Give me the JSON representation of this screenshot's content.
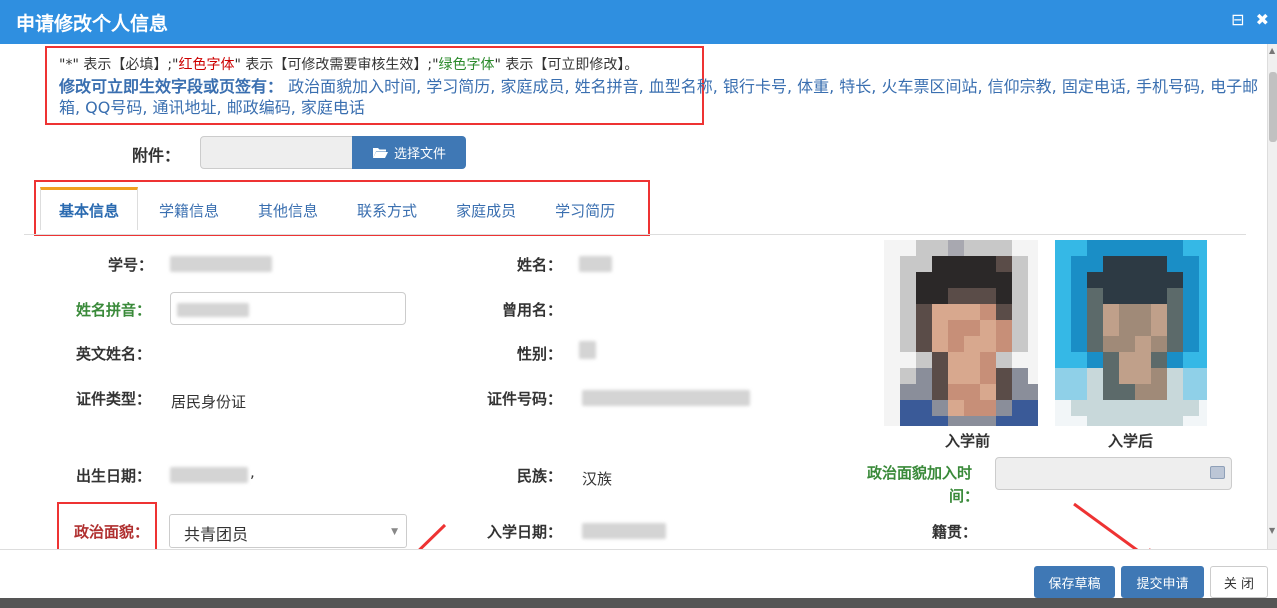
{
  "window": {
    "title": "申请修改个人信息",
    "restore_glyph": "⊟",
    "close_glyph": "✖"
  },
  "notice": {
    "l1_part1": "\"*\" 表示【必填】;\"",
    "l1_red": "红色字体",
    "l1_part2": "\" 表示【可修改需要审核生效】;\"",
    "l1_green": "绿色字体",
    "l1_part3": "\" 表示【可立即修改】。",
    "l2_bold": "修改可立即生效字段或页签有：",
    "l2_fields": " 政治面貌加入时间, 学习简历, 家庭成员, 姓名拼音, 血型名称, 银行卡号, 体重, 特长, 火车票区间站, 信仰宗教, 固定电话, 手机号码, 电子邮箱, QQ号码, 通讯地址, 邮政编码, 家庭电话"
  },
  "attachment": {
    "label": "附件：",
    "button": "选择文件"
  },
  "tabs": [
    "基本信息",
    "学籍信息",
    "其他信息",
    "联系方式",
    "家庭成员",
    "学习简历"
  ],
  "form": {
    "student_id_label": "学号：",
    "name_label": "姓名：",
    "pinyin_label": "姓名拼音：",
    "former_name_label": "曾用名：",
    "english_name_label": "英文姓名：",
    "gender_label": "性别：",
    "id_type_label": "证件类型：",
    "id_type_value": "居民身份证",
    "id_number_label": "证件号码：",
    "birth_label": "出生日期：",
    "birth_suffix": ",",
    "ethnicity_label": "民族：",
    "ethnicity_value": "汉族",
    "join_time_label_1": "政治面貌加入时",
    "join_time_label_2": "间：",
    "political_label": "政治面貌：",
    "political_value": "共青团员",
    "enroll_label": "入学日期：",
    "native_label": "籍贯："
  },
  "photos": {
    "before_caption": "入学前",
    "after_caption": "入学后"
  },
  "footer": {
    "save": "保存草稿",
    "submit": "提交申请",
    "close": "关 闭"
  },
  "colors": {
    "title_bar": "#2f8fe0",
    "button": "#3f78b5",
    "annotation_red": "#ee3333"
  }
}
